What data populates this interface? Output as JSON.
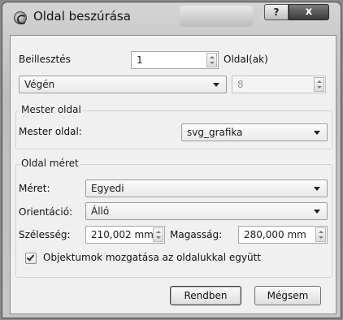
{
  "window": {
    "title": "Oldal beszúrása",
    "help_glyph": "?",
    "close_glyph": "x"
  },
  "insert": {
    "label": "Beillesztés",
    "count_value": "1",
    "unit_label": "Oldal(ak)",
    "position_value": "Végén",
    "page_number_value": "8"
  },
  "master_group": {
    "title": "Mester oldal",
    "label": "Mester oldal:",
    "value": "svg_grafika"
  },
  "size_group": {
    "title": "Oldal méret",
    "size_label": "Méret:",
    "size_value": "Egyedi",
    "orientation_label": "Orientáció:",
    "orientation_value": "Álló",
    "width_label": "Szélesség:",
    "width_value": "210,002 mm",
    "height_label": "Magasság:",
    "height_value": "280,000 mm",
    "move_objects_label": "Objektumok mozgatása az oldalukkal együtt",
    "move_objects_checked": true
  },
  "buttons": {
    "ok_label": "Rendben",
    "cancel_label": "Mégsem"
  }
}
